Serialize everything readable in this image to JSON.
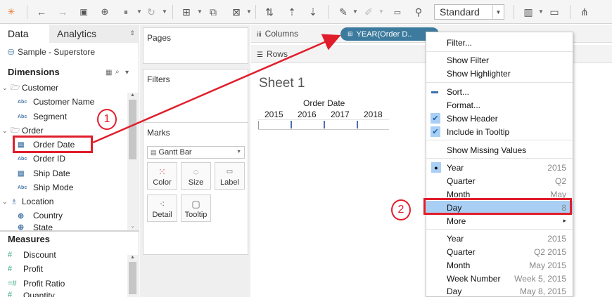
{
  "toolbar": {
    "icons": [
      "tableau-logo-icon",
      "back-icon",
      "forward-icon",
      "save-icon",
      "new-datasource-icon",
      "pause-icon",
      "refresh-icon",
      "new-sheet-icon",
      "duplicate-sheet-icon",
      "clear-sheet-icon",
      "swap-icon",
      "sort-ascending-icon",
      "sort-descending-icon",
      "highlight-icon",
      "annotate-icon",
      "label-icon",
      "pin-icon",
      "show-me-icon",
      "present-icon",
      "share-icon"
    ],
    "view_size": "Standard"
  },
  "data_pane": {
    "tab_data": "Data",
    "tab_analytics": "Analytics",
    "datasource": "Sample - Superstore",
    "dimensions_label": "Dimensions",
    "measures_label": "Measures",
    "dimensions": [
      {
        "label": "Customer",
        "kind": "folder"
      },
      {
        "label": "Customer Name",
        "kind": "abc"
      },
      {
        "label": "Segment",
        "kind": "abc"
      },
      {
        "label": "Order",
        "kind": "folder"
      },
      {
        "label": "Order Date",
        "kind": "date"
      },
      {
        "label": "Order ID",
        "kind": "abc"
      },
      {
        "label": "Ship Date",
        "kind": "date"
      },
      {
        "label": "Ship Mode",
        "kind": "abc"
      },
      {
        "label": "Location",
        "kind": "hierarchy"
      },
      {
        "label": "Country",
        "kind": "geo"
      },
      {
        "label": "State",
        "kind": "geo"
      }
    ],
    "measures": [
      {
        "label": "Discount"
      },
      {
        "label": "Profit"
      },
      {
        "label": "Profit Ratio"
      },
      {
        "label": "Quantity"
      }
    ]
  },
  "shelves": {
    "pages": "Pages",
    "filters": "Filters",
    "marks": "Marks",
    "mark_type": "Gantt Bar",
    "mark_buttons": [
      {
        "label": "Color"
      },
      {
        "label": "Size"
      },
      {
        "label": "Label"
      },
      {
        "label": "Detail"
      },
      {
        "label": "Tooltip"
      }
    ]
  },
  "canvas": {
    "columns_label": "Columns",
    "rows_label": "Rows",
    "pill_label": "YEAR(Order D..",
    "sheet_title": "Sheet 1",
    "header": "Order Date",
    "years": [
      "2015",
      "2016",
      "2017",
      "2018"
    ]
  },
  "context_menu": {
    "items": [
      {
        "label": "Filter...",
        "value": ""
      },
      {
        "label": "Show Filter",
        "value": ""
      },
      {
        "label": "Show Highlighter",
        "value": ""
      },
      {
        "label": "Sort...",
        "value": ""
      },
      {
        "label": "Format...",
        "value": ""
      },
      {
        "label": "Show Header",
        "value": ""
      },
      {
        "label": "Include in Tooltip",
        "value": ""
      },
      {
        "label": "Show Missing Values",
        "value": ""
      },
      {
        "label": "Year",
        "value": "2015"
      },
      {
        "label": "Quarter",
        "value": "Q2"
      },
      {
        "label": "Month",
        "value": "May"
      },
      {
        "label": "Day",
        "value": "8"
      },
      {
        "label": "More",
        "value": "▸"
      },
      {
        "label": "Year",
        "value": "2015"
      },
      {
        "label": "Quarter",
        "value": "Q2 2015"
      },
      {
        "label": "Month",
        "value": "May 2015"
      },
      {
        "label": "Week Number",
        "value": "Week 5, 2015"
      },
      {
        "label": "Day",
        "value": "May 8, 2015"
      }
    ]
  },
  "annotations": {
    "callout_1": "1",
    "callout_2": "2",
    "color": "#e01e2b"
  },
  "colors": {
    "pill": "#3d7b9e",
    "menu_highlight": "#a9cff4",
    "gantt": "#4c6fb0"
  }
}
